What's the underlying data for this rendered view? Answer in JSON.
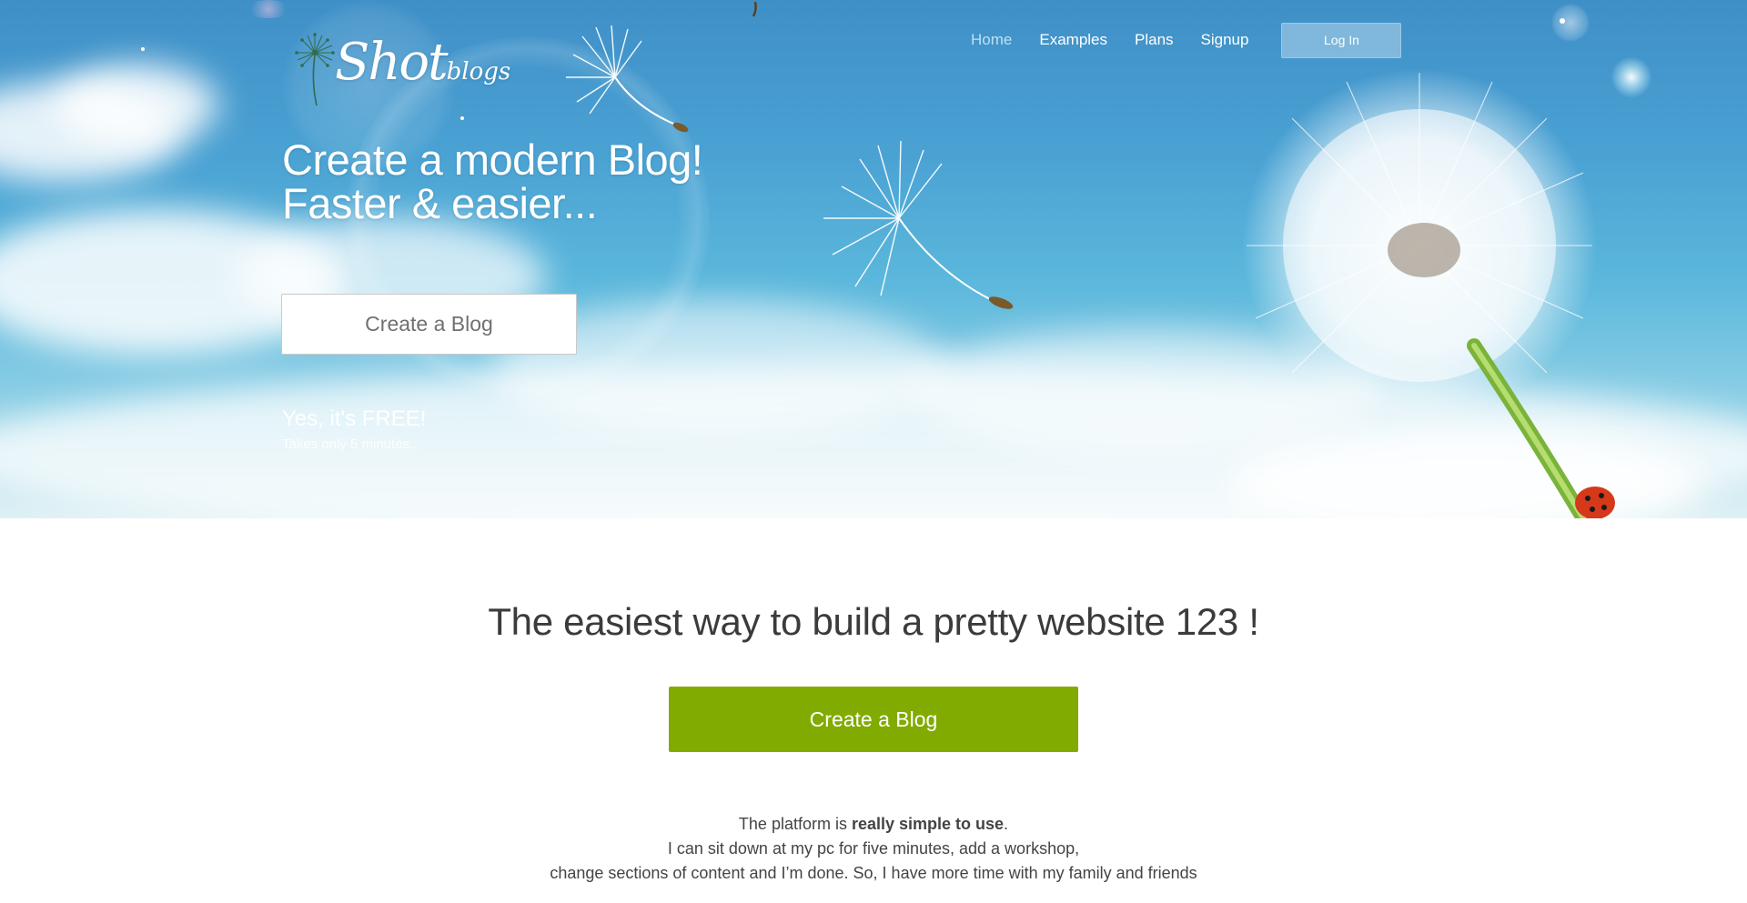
{
  "brand": {
    "script": "Shot",
    "small": "blogs"
  },
  "nav": {
    "items": [
      {
        "label": "Home",
        "active": true
      },
      {
        "label": "Examples",
        "active": false
      },
      {
        "label": "Plans",
        "active": false
      },
      {
        "label": "Signup",
        "active": false
      }
    ],
    "login_label": "Log In"
  },
  "hero": {
    "headline_line1": "Create a modern Blog!",
    "headline_line2": "Faster & easier...",
    "button_label": "Create a Blog",
    "free_text": "Yes, it's FREE!",
    "takes_text": "Takes only 5 minutes..."
  },
  "main": {
    "tagline": "The easiest way to build a pretty website 123 !",
    "cta_label": "Create a Blog",
    "testimonial": {
      "line1_pre": "The platform is ",
      "line1_bold": "really simple to use",
      "line1_post": ".",
      "line2": "I can sit down at my pc for five minutes, add a workshop,",
      "line3": "change sections of content and I’m done. So, I have more time with my family and friends"
    }
  },
  "colors": {
    "cta_green": "#82ab02",
    "sky_top": "#3f8fc7",
    "sky_bottom": "#dff1f5",
    "text_dark": "#3b3b3b"
  }
}
